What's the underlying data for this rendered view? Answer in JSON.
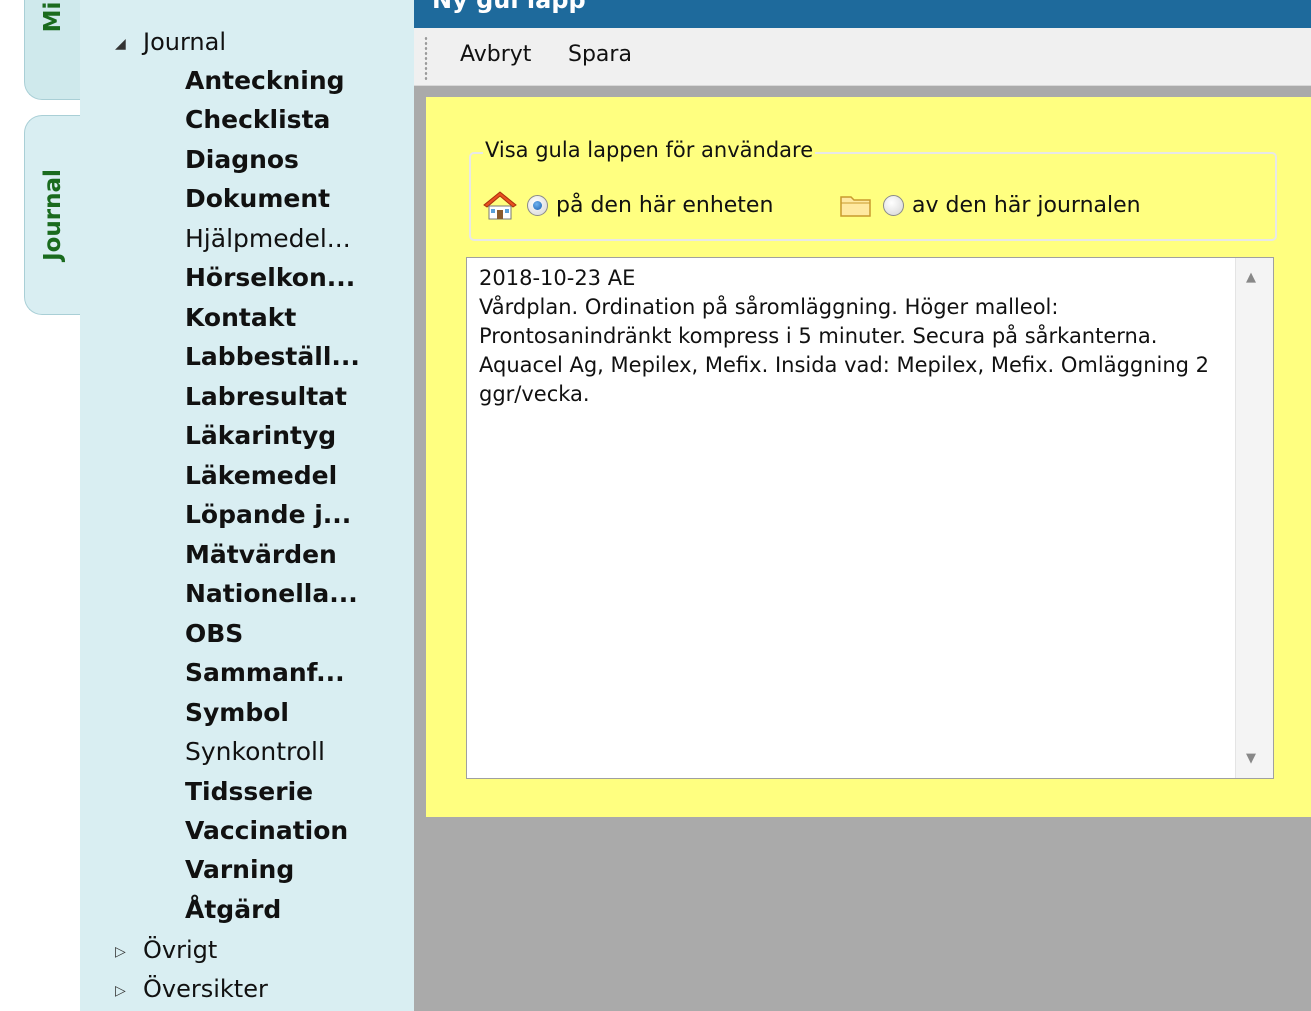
{
  "tabs": {
    "mi_label": "Mi",
    "journal_label": "Journal"
  },
  "tree": {
    "journal_label": "Journal",
    "journal_expander": "◢",
    "children": [
      {
        "label": "Anteckning",
        "bold": true
      },
      {
        "label": "Checklista",
        "bold": true
      },
      {
        "label": "Diagnos",
        "bold": true
      },
      {
        "label": "Dokument",
        "bold": true
      },
      {
        "label": "Hjälpmedel...",
        "bold": false
      },
      {
        "label": "Hörselkon...",
        "bold": true
      },
      {
        "label": "Kontakt",
        "bold": true
      },
      {
        "label": "Labbeställ...",
        "bold": true
      },
      {
        "label": "Labresultat",
        "bold": true
      },
      {
        "label": "Läkarintyg",
        "bold": true
      },
      {
        "label": "Läkemedel",
        "bold": true
      },
      {
        "label": "Löpande j...",
        "bold": true
      },
      {
        "label": "Mätvärden",
        "bold": true
      },
      {
        "label": "Nationella...",
        "bold": true
      },
      {
        "label": "OBS",
        "bold": true
      },
      {
        "label": "Sammanf...",
        "bold": true
      },
      {
        "label": "Symbol",
        "bold": true
      },
      {
        "label": "Synkontroll",
        "bold": false
      },
      {
        "label": "Tidsserie",
        "bold": true
      },
      {
        "label": "Vaccination",
        "bold": true
      },
      {
        "label": "Varning",
        "bold": true
      },
      {
        "label": "Åtgärd",
        "bold": true
      }
    ],
    "ovrigt_label": "Övrigt",
    "oversikter_label": "Översikter",
    "collapsed_expander": "▷"
  },
  "window": {
    "title": "Ny gul lapp"
  },
  "toolbar": {
    "cancel_label": "Avbryt",
    "save_label": "Spara"
  },
  "visibility": {
    "legend": "Visa gula lappen för användare",
    "option_unit": "på den här enheten",
    "option_journal": "av den här journalen",
    "selected": "unit"
  },
  "note": {
    "lines": [
      "2018-10-23  AE",
      "Vårdplan. Ordination på såromläggning. Höger malleol:",
      "Prontosanindränkt kompress i 5 minuter. Secura på sårkanterna.",
      "Aquacel Ag, Mepilex, Mefix. Insida vad: Mepilex, Mefix. Omläggning 2",
      "ggr/vecka."
    ]
  },
  "icons": {
    "unit": "home-icon",
    "journal": "folder-icon"
  },
  "colors": {
    "note_background": "#ffff80",
    "titlebar": "#1e6a9c",
    "tree_background": "#d9eef2",
    "tab_text": "#1a6b1e"
  }
}
